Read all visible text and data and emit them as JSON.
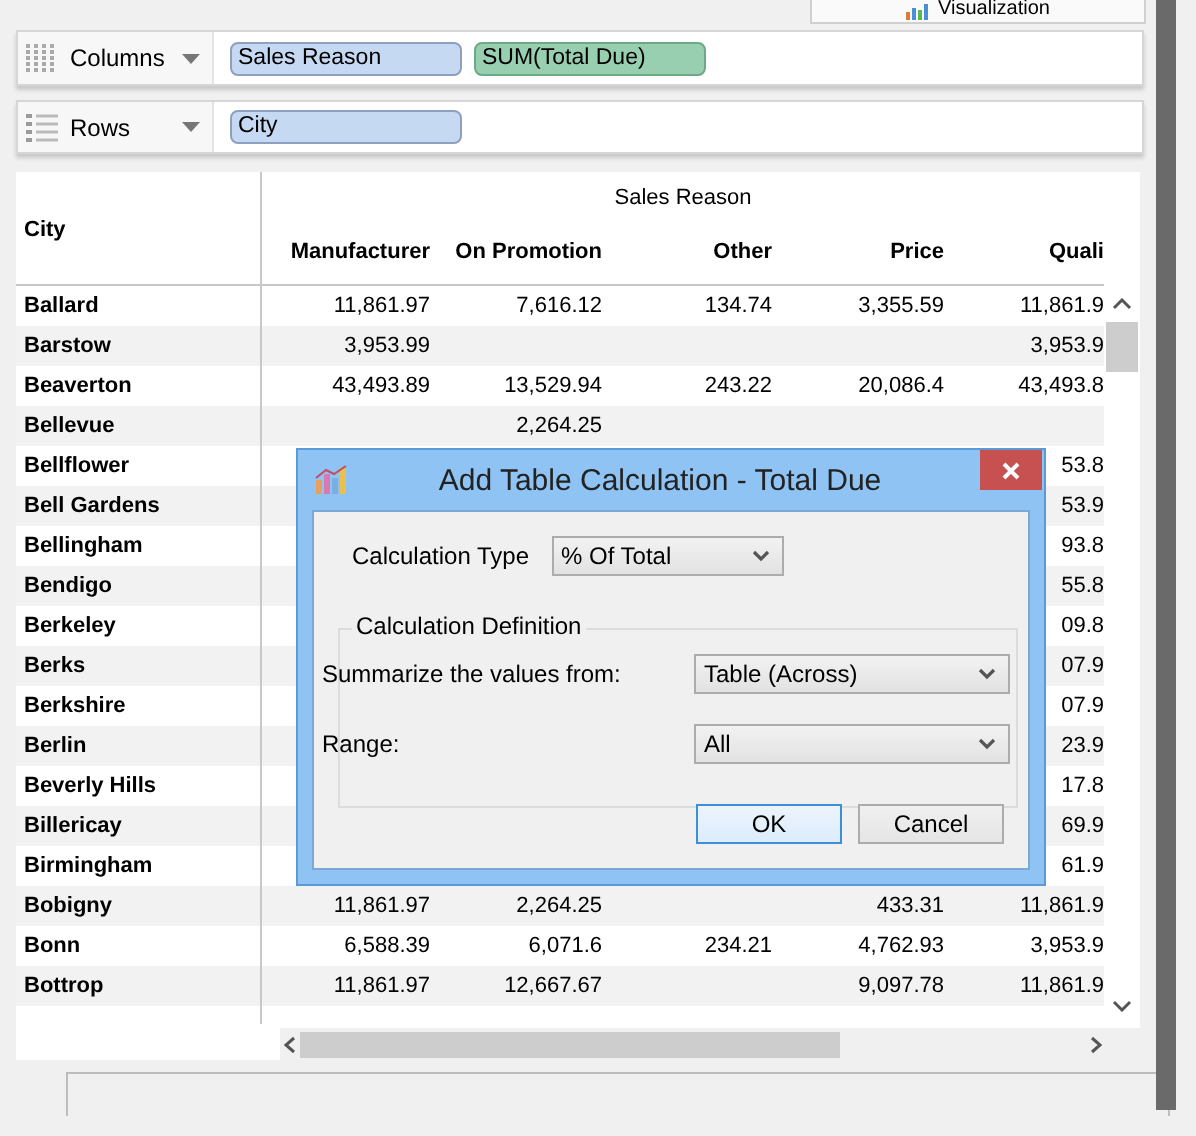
{
  "top_tab": {
    "label": "Visualization"
  },
  "shelves": [
    {
      "label": "Columns",
      "kind": "columns",
      "pills": [
        {
          "label": "Sales Reason",
          "kind": "dimension"
        },
        {
          "label": "SUM(Total Due)",
          "kind": "measure"
        }
      ]
    },
    {
      "label": "Rows",
      "kind": "rows",
      "pills": [
        {
          "label": "City",
          "kind": "dimension"
        }
      ]
    }
  ],
  "table": {
    "row_header": "City",
    "column_group": "Sales Reason",
    "columns": [
      "Manufacturer",
      "On Promotion",
      "Other",
      "Price",
      "Quali"
    ],
    "rows": [
      {
        "city": "Ballard",
        "cells": [
          "11,861.97",
          "7,616.12",
          "134.74",
          "3,355.59",
          "11,861.9"
        ]
      },
      {
        "city": "Barstow",
        "cells": [
          "3,953.99",
          null,
          null,
          null,
          "3,953.9"
        ]
      },
      {
        "city": "Beaverton",
        "cells": [
          "43,493.89",
          "13,529.94",
          "243.22",
          "20,086.4",
          "43,493.8"
        ]
      },
      {
        "city": "Bellevue",
        "cells": [
          null,
          "2,264.25",
          null,
          null,
          null
        ]
      },
      {
        "city": "Bellflower",
        "cells": [
          null,
          null,
          null,
          null,
          "53.8"
        ]
      },
      {
        "city": "Bell Gardens",
        "cells": [
          null,
          null,
          null,
          null,
          "53.9"
        ]
      },
      {
        "city": "Bellingham",
        "cells": [
          null,
          null,
          null,
          null,
          "93.8"
        ]
      },
      {
        "city": "Bendigo",
        "cells": [
          null,
          null,
          null,
          null,
          "55.8"
        ]
      },
      {
        "city": "Berkeley",
        "cells": [
          null,
          null,
          null,
          null,
          "09.8"
        ]
      },
      {
        "city": "Berks",
        "cells": [
          null,
          null,
          null,
          null,
          "07.9"
        ]
      },
      {
        "city": "Berkshire",
        "cells": [
          null,
          null,
          null,
          null,
          "07.9"
        ]
      },
      {
        "city": "Berlin",
        "cells": [
          null,
          null,
          null,
          null,
          "23.9"
        ]
      },
      {
        "city": "Beverly Hills",
        "cells": [
          null,
          null,
          null,
          null,
          "17.8"
        ]
      },
      {
        "city": "Billericay",
        "cells": [
          null,
          null,
          null,
          null,
          "69.9"
        ]
      },
      {
        "city": "Birmingham",
        "cells": [
          null,
          null,
          null,
          null,
          "61.9"
        ]
      },
      {
        "city": "Bobigny",
        "cells": [
          "11,861.97",
          "2,264.25",
          null,
          "433.31",
          "11,861.9"
        ]
      },
      {
        "city": "Bonn",
        "cells": [
          "6,588.39",
          "6,071.6",
          "234.21",
          "4,762.93",
          "3,953.9"
        ]
      },
      {
        "city": "Bottrop",
        "cells": [
          "11,861.97",
          "12,667.67",
          null,
          "9,097.78",
          "11,861.9"
        ]
      }
    ]
  },
  "dialog": {
    "title": "Add Table Calculation - Total Due",
    "calculation_type": {
      "label": "Calculation Type",
      "value": "% Of Total"
    },
    "group": {
      "title": "Calculation Definition",
      "fields": [
        {
          "label": "Summarize the values from:",
          "value": "Table (Across)"
        },
        {
          "label": "Range:",
          "value": "All"
        }
      ]
    },
    "buttons": [
      {
        "label": "OK",
        "focused": true
      },
      {
        "label": "Cancel",
        "focused": false
      }
    ]
  }
}
